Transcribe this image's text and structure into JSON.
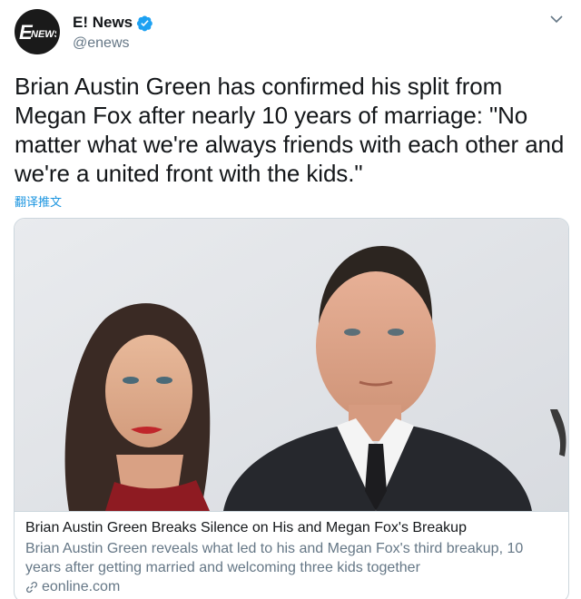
{
  "account": {
    "display_name": "E! News",
    "handle": "@enews",
    "avatar_logo": "E! NEWS",
    "verified_icon": "verified-badge-icon"
  },
  "tweet": {
    "text": "Brian Austin Green has confirmed his split from Megan Fox after nearly 10 years of marriage: \"No matter what we're always friends with each other and we're a united front with the kids.\"",
    "translate_label": "翻译推文"
  },
  "card": {
    "title": "Brian Austin Green Breaks Silence on His and Megan Fox's Breakup",
    "description": "Brian Austin Green reveals what led to his and Megan Fox's third breakup, 10 years after getting married and welcoming three kids together",
    "domain": "eonline.com",
    "link_icon": "link-icon"
  },
  "colors": {
    "text": "#14171a",
    "secondary": "#657786",
    "link": "#1b95e0",
    "verified": "#1da1f2",
    "border": "#ccd6dd"
  }
}
